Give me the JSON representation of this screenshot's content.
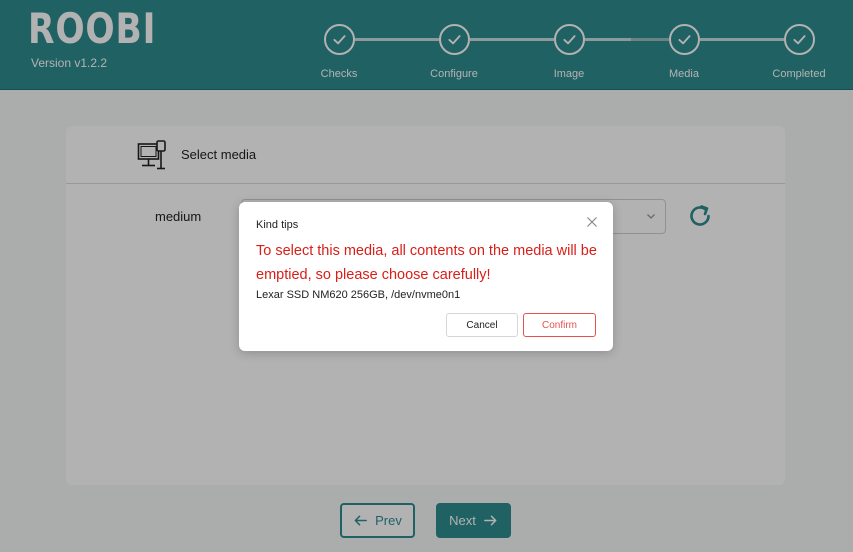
{
  "app": {
    "title": "ROOBI",
    "version": "Version v1.2.2",
    "accent_color": "#2e8c8f"
  },
  "steps": [
    {
      "label": "Checks",
      "status": "completed",
      "icon": "check-icon"
    },
    {
      "label": "Configure",
      "status": "completed",
      "icon": "check-icon"
    },
    {
      "label": "Image",
      "status": "completed",
      "icon": "check-icon"
    },
    {
      "label": "Media",
      "status": "completed",
      "icon": "check-icon"
    },
    {
      "label": "Completed",
      "status": "completed",
      "icon": "check-icon"
    }
  ],
  "card": {
    "title": "Select media",
    "title_icon": "computer-media-icon",
    "field_label": "medium",
    "select_value": "",
    "refresh_icon": "refresh-icon"
  },
  "nav": {
    "prev_label": "Prev",
    "next_label": "Next"
  },
  "dialog": {
    "title": "Kind tips",
    "warning": "To select this media, all contents on the media will be emptied, so please choose carefully!",
    "device": "Lexar SSD NM620 256GB, /dev/nvme0n1",
    "cancel_label": "Cancel",
    "confirm_label": "Confirm",
    "warning_color": "#d91e18"
  }
}
